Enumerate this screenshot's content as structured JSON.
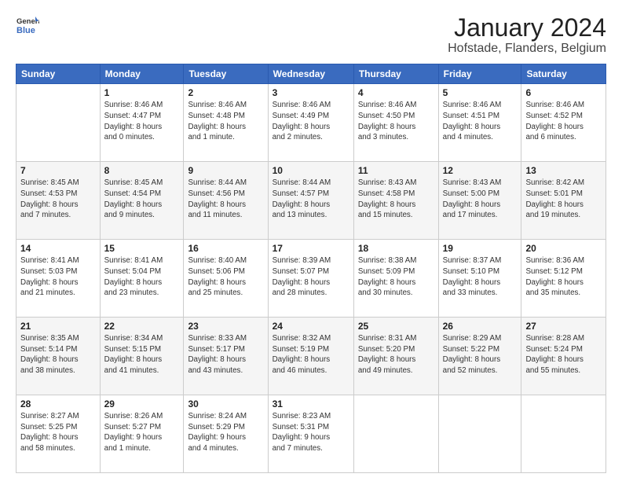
{
  "logo": {
    "line1": "General",
    "line2": "Blue"
  },
  "title": "January 2024",
  "subtitle": "Hofstade, Flanders, Belgium",
  "headers": [
    "Sunday",
    "Monday",
    "Tuesday",
    "Wednesday",
    "Thursday",
    "Friday",
    "Saturday"
  ],
  "weeks": [
    [
      {
        "day": "",
        "info": ""
      },
      {
        "day": "1",
        "info": "Sunrise: 8:46 AM\nSunset: 4:47 PM\nDaylight: 8 hours\nand 0 minutes."
      },
      {
        "day": "2",
        "info": "Sunrise: 8:46 AM\nSunset: 4:48 PM\nDaylight: 8 hours\nand 1 minute."
      },
      {
        "day": "3",
        "info": "Sunrise: 8:46 AM\nSunset: 4:49 PM\nDaylight: 8 hours\nand 2 minutes."
      },
      {
        "day": "4",
        "info": "Sunrise: 8:46 AM\nSunset: 4:50 PM\nDaylight: 8 hours\nand 3 minutes."
      },
      {
        "day": "5",
        "info": "Sunrise: 8:46 AM\nSunset: 4:51 PM\nDaylight: 8 hours\nand 4 minutes."
      },
      {
        "day": "6",
        "info": "Sunrise: 8:46 AM\nSunset: 4:52 PM\nDaylight: 8 hours\nand 6 minutes."
      }
    ],
    [
      {
        "day": "7",
        "info": "Sunrise: 8:45 AM\nSunset: 4:53 PM\nDaylight: 8 hours\nand 7 minutes."
      },
      {
        "day": "8",
        "info": "Sunrise: 8:45 AM\nSunset: 4:54 PM\nDaylight: 8 hours\nand 9 minutes."
      },
      {
        "day": "9",
        "info": "Sunrise: 8:44 AM\nSunset: 4:56 PM\nDaylight: 8 hours\nand 11 minutes."
      },
      {
        "day": "10",
        "info": "Sunrise: 8:44 AM\nSunset: 4:57 PM\nDaylight: 8 hours\nand 13 minutes."
      },
      {
        "day": "11",
        "info": "Sunrise: 8:43 AM\nSunset: 4:58 PM\nDaylight: 8 hours\nand 15 minutes."
      },
      {
        "day": "12",
        "info": "Sunrise: 8:43 AM\nSunset: 5:00 PM\nDaylight: 8 hours\nand 17 minutes."
      },
      {
        "day": "13",
        "info": "Sunrise: 8:42 AM\nSunset: 5:01 PM\nDaylight: 8 hours\nand 19 minutes."
      }
    ],
    [
      {
        "day": "14",
        "info": "Sunrise: 8:41 AM\nSunset: 5:03 PM\nDaylight: 8 hours\nand 21 minutes."
      },
      {
        "day": "15",
        "info": "Sunrise: 8:41 AM\nSunset: 5:04 PM\nDaylight: 8 hours\nand 23 minutes."
      },
      {
        "day": "16",
        "info": "Sunrise: 8:40 AM\nSunset: 5:06 PM\nDaylight: 8 hours\nand 25 minutes."
      },
      {
        "day": "17",
        "info": "Sunrise: 8:39 AM\nSunset: 5:07 PM\nDaylight: 8 hours\nand 28 minutes."
      },
      {
        "day": "18",
        "info": "Sunrise: 8:38 AM\nSunset: 5:09 PM\nDaylight: 8 hours\nand 30 minutes."
      },
      {
        "day": "19",
        "info": "Sunrise: 8:37 AM\nSunset: 5:10 PM\nDaylight: 8 hours\nand 33 minutes."
      },
      {
        "day": "20",
        "info": "Sunrise: 8:36 AM\nSunset: 5:12 PM\nDaylight: 8 hours\nand 35 minutes."
      }
    ],
    [
      {
        "day": "21",
        "info": "Sunrise: 8:35 AM\nSunset: 5:14 PM\nDaylight: 8 hours\nand 38 minutes."
      },
      {
        "day": "22",
        "info": "Sunrise: 8:34 AM\nSunset: 5:15 PM\nDaylight: 8 hours\nand 41 minutes."
      },
      {
        "day": "23",
        "info": "Sunrise: 8:33 AM\nSunset: 5:17 PM\nDaylight: 8 hours\nand 43 minutes."
      },
      {
        "day": "24",
        "info": "Sunrise: 8:32 AM\nSunset: 5:19 PM\nDaylight: 8 hours\nand 46 minutes."
      },
      {
        "day": "25",
        "info": "Sunrise: 8:31 AM\nSunset: 5:20 PM\nDaylight: 8 hours\nand 49 minutes."
      },
      {
        "day": "26",
        "info": "Sunrise: 8:29 AM\nSunset: 5:22 PM\nDaylight: 8 hours\nand 52 minutes."
      },
      {
        "day": "27",
        "info": "Sunrise: 8:28 AM\nSunset: 5:24 PM\nDaylight: 8 hours\nand 55 minutes."
      }
    ],
    [
      {
        "day": "28",
        "info": "Sunrise: 8:27 AM\nSunset: 5:25 PM\nDaylight: 8 hours\nand 58 minutes."
      },
      {
        "day": "29",
        "info": "Sunrise: 8:26 AM\nSunset: 5:27 PM\nDaylight: 9 hours\nand 1 minute."
      },
      {
        "day": "30",
        "info": "Sunrise: 8:24 AM\nSunset: 5:29 PM\nDaylight: 9 hours\nand 4 minutes."
      },
      {
        "day": "31",
        "info": "Sunrise: 8:23 AM\nSunset: 5:31 PM\nDaylight: 9 hours\nand 7 minutes."
      },
      {
        "day": "",
        "info": ""
      },
      {
        "day": "",
        "info": ""
      },
      {
        "day": "",
        "info": ""
      }
    ]
  ]
}
